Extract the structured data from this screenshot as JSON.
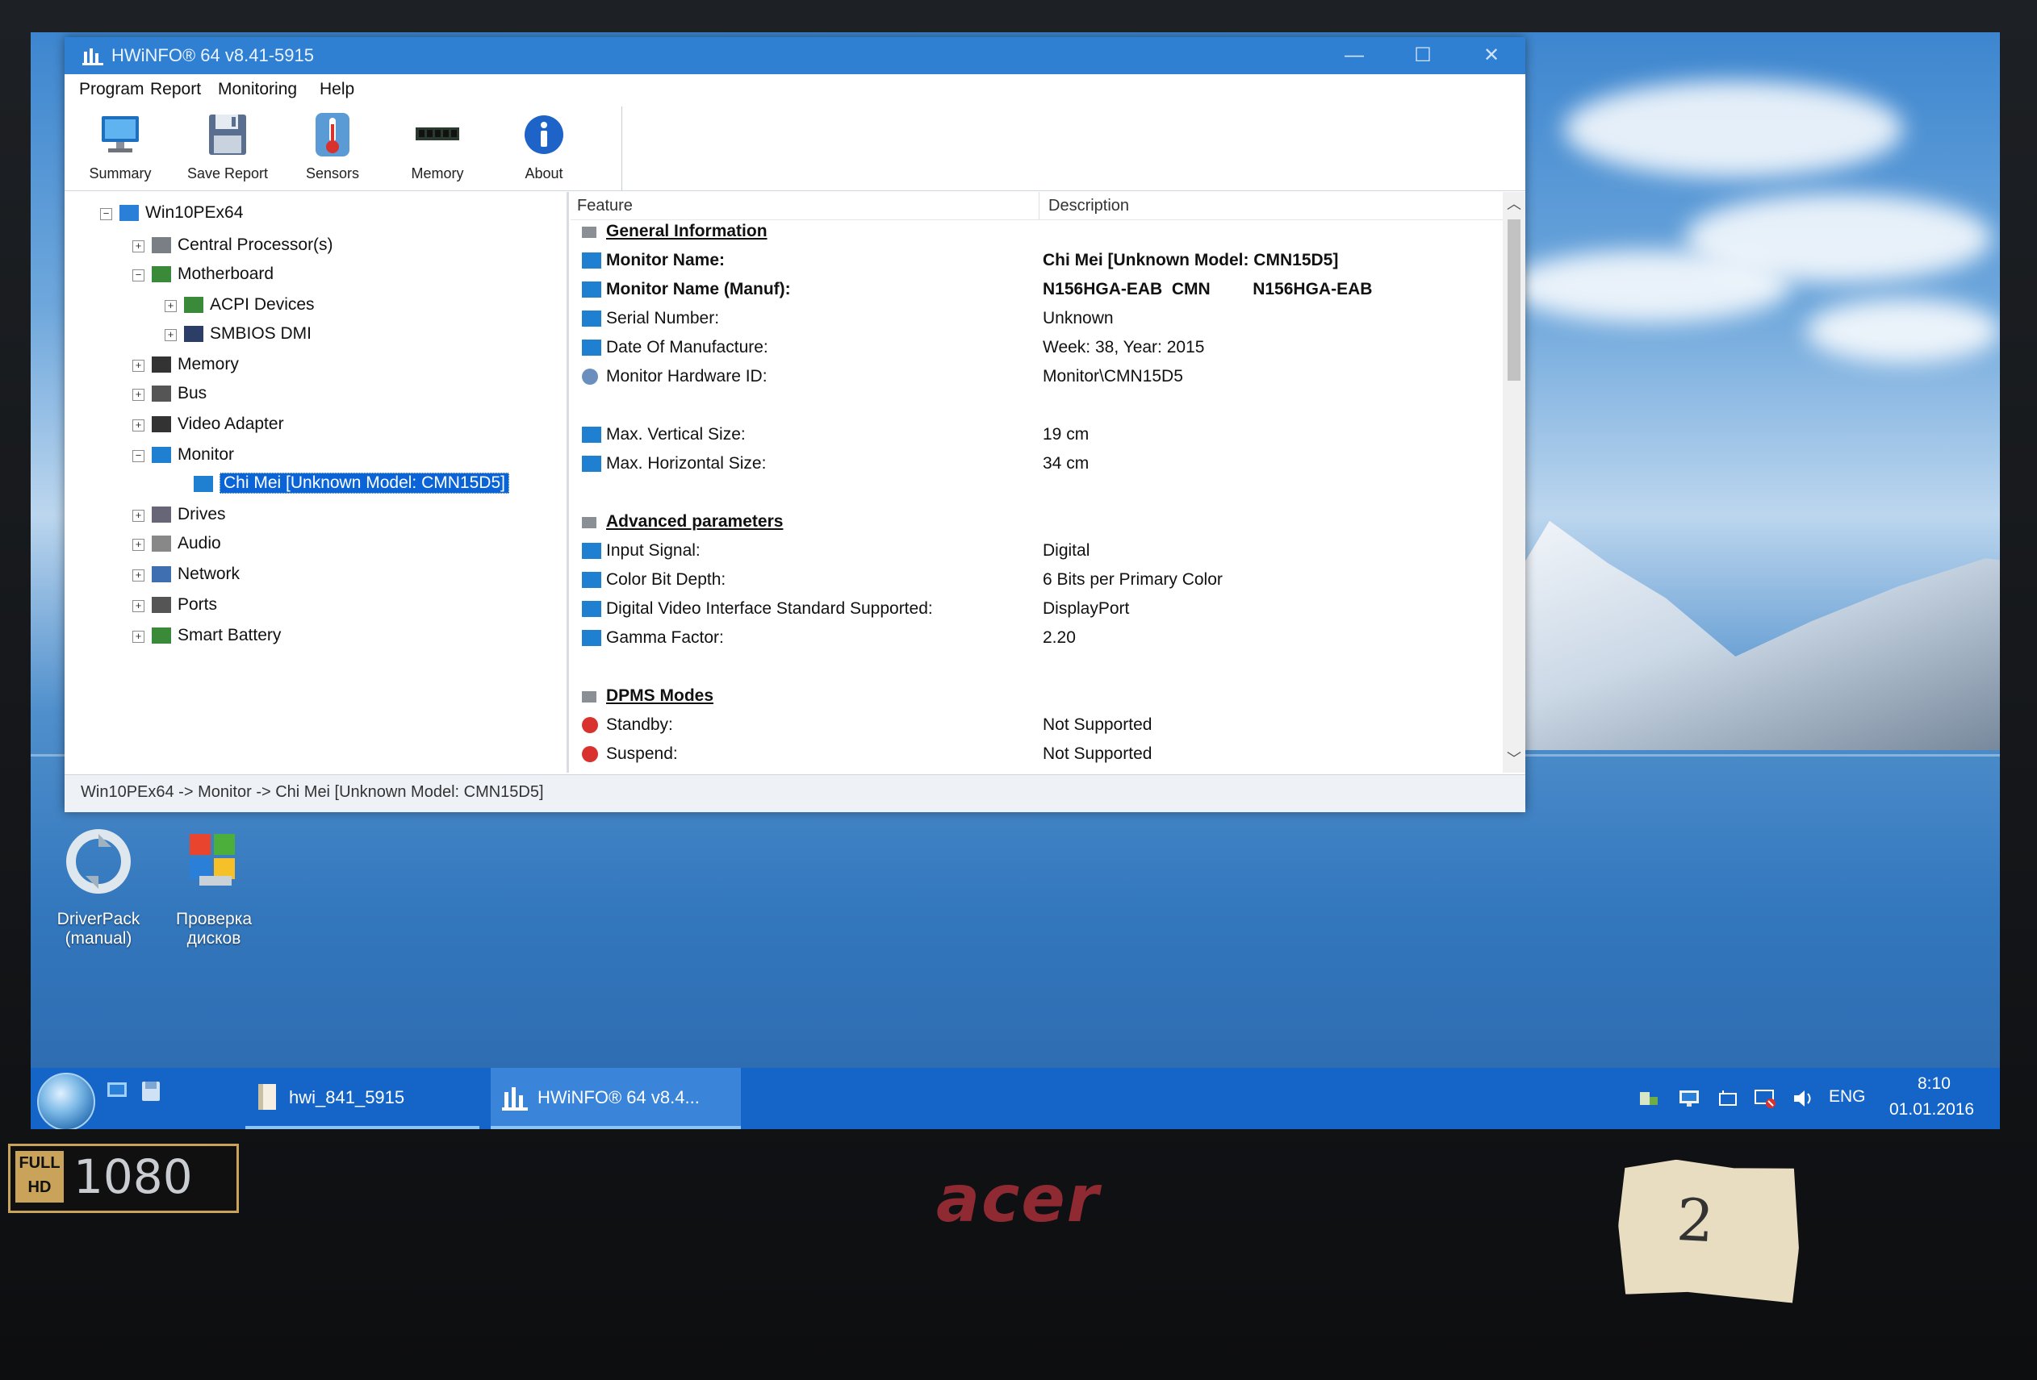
{
  "window": {
    "title": "HWiNFO® 64 v8.41-5915",
    "controls": {
      "minimize": "—",
      "maximize": "☐",
      "close": "✕"
    }
  },
  "menu": [
    "Program",
    "Report",
    "Monitoring",
    "Help"
  ],
  "toolbar": [
    {
      "label": "Summary",
      "icon": "monitor-icon"
    },
    {
      "label": "Save Report",
      "icon": "floppy-disk-icon"
    },
    {
      "label": "Sensors",
      "icon": "thermometer-icon"
    },
    {
      "label": "Memory",
      "icon": "memory-module-icon"
    },
    {
      "label": "About",
      "icon": "info-icon"
    }
  ],
  "tree": [
    {
      "label": "Win10PEx64",
      "expander": "−",
      "icon": "computer-icon"
    },
    {
      "label": "Central Processor(s)",
      "expander": "+",
      "icon": "cpu-icon"
    },
    {
      "label": "Motherboard",
      "expander": "−",
      "icon": "motherboard-icon"
    },
    {
      "label": "ACPI Devices",
      "expander": "+",
      "icon": "acpi-icon"
    },
    {
      "label": "SMBIOS DMI",
      "expander": "+",
      "icon": "dmi-icon"
    },
    {
      "label": "Memory",
      "expander": "+",
      "icon": "memory-icon"
    },
    {
      "label": "Bus",
      "expander": "+",
      "icon": "bus-icon"
    },
    {
      "label": "Video Adapter",
      "expander": "+",
      "icon": "video-adapter-icon"
    },
    {
      "label": "Monitor",
      "expander": "−",
      "icon": "monitor-icon"
    },
    {
      "label": "Chi Mei [Unknown Model: CMN15D5]",
      "expander": "",
      "icon": "monitor-icon",
      "selected": true
    },
    {
      "label": "Drives",
      "expander": "+",
      "icon": "drive-icon"
    },
    {
      "label": "Audio",
      "expander": "+",
      "icon": "audio-icon"
    },
    {
      "label": "Network",
      "expander": "+",
      "icon": "network-icon"
    },
    {
      "label": "Ports",
      "expander": "+",
      "icon": "ports-icon"
    },
    {
      "label": "Smart Battery",
      "expander": "+",
      "icon": "battery-icon"
    }
  ],
  "detail": {
    "columns": {
      "feature": "Feature",
      "description": "Description"
    },
    "rows": [
      {
        "type": "section",
        "feature": "General Information",
        "desc": ""
      },
      {
        "type": "item",
        "bold": true,
        "feature": "Monitor Name:",
        "desc": "Chi Mei [Unknown Model: CMN15D5]",
        "icon": "monitor-icon"
      },
      {
        "type": "item",
        "bold": true,
        "feature": "Monitor Name (Manuf):",
        "desc": "N156HGA-EAB  CMN         N156HGA-EAB",
        "icon": "monitor-icon"
      },
      {
        "type": "item",
        "feature": "Serial Number:",
        "desc": "Unknown",
        "icon": "monitor-icon"
      },
      {
        "type": "item",
        "feature": "Date Of Manufacture:",
        "desc": "Week: 38, Year: 2015",
        "icon": "monitor-icon"
      },
      {
        "type": "item",
        "feature": "Monitor Hardware ID:",
        "desc": "Monitor\\CMN15D5",
        "icon": "hardware-id-icon"
      },
      {
        "type": "blank",
        "feature": "",
        "desc": ""
      },
      {
        "type": "item",
        "feature": "Max. Vertical Size:",
        "desc": "19 cm",
        "icon": "monitor-icon"
      },
      {
        "type": "item",
        "feature": "Max. Horizontal Size:",
        "desc": "34 cm",
        "icon": "monitor-icon"
      },
      {
        "type": "blank",
        "feature": "",
        "desc": ""
      },
      {
        "type": "section",
        "feature": "Advanced parameters",
        "desc": ""
      },
      {
        "type": "item",
        "feature": "Input Signal:",
        "desc": "Digital",
        "icon": "monitor-icon"
      },
      {
        "type": "item",
        "feature": "Color Bit Depth:",
        "desc": "6 Bits per Primary Color",
        "icon": "monitor-icon"
      },
      {
        "type": "item",
        "feature": "Digital Video Interface Standard Supported:",
        "desc": "DisplayPort",
        "icon": "monitor-icon"
      },
      {
        "type": "item",
        "feature": "Gamma Factor:",
        "desc": "2.20",
        "icon": "monitor-icon"
      },
      {
        "type": "blank",
        "feature": "",
        "desc": ""
      },
      {
        "type": "section",
        "feature": "DPMS Modes",
        "desc": ""
      },
      {
        "type": "item",
        "feature": "Standby:",
        "desc": "Not Supported",
        "icon": "error-icon"
      },
      {
        "type": "item",
        "feature": "Suspend:",
        "desc": "Not Supported",
        "icon": "error-icon"
      }
    ]
  },
  "statusbar": "Win10PEx64 -> Monitor -> Chi Mei [Unknown Model: CMN15D5]",
  "desktop_icons": [
    {
      "line1": "DriverPack",
      "line2": "(manual)",
      "icon": "driverpack-icon"
    },
    {
      "line1": "Проверка",
      "line2": "дисков",
      "icon": "disk-check-icon"
    }
  ],
  "taskbar": {
    "tasks": [
      {
        "label": "hwi_841_5915",
        "icon": "file-icon",
        "active": false
      },
      {
        "label": "HWiNFO® 64 v8.4...",
        "icon": "hwinfo-icon",
        "active": true
      }
    ],
    "language": "ENG",
    "time": "8:10",
    "date": "01.01.2016"
  },
  "hardware": {
    "badge_top": "FULL",
    "badge_bottom": "HD",
    "badge_number": "1080",
    "brand": "acer",
    "sticker": "2"
  },
  "colors": {
    "titlebar": "#2f7fd3",
    "selection": "#0a64d8",
    "taskbar": "#1565c9",
    "brand": "#8f2a33"
  }
}
